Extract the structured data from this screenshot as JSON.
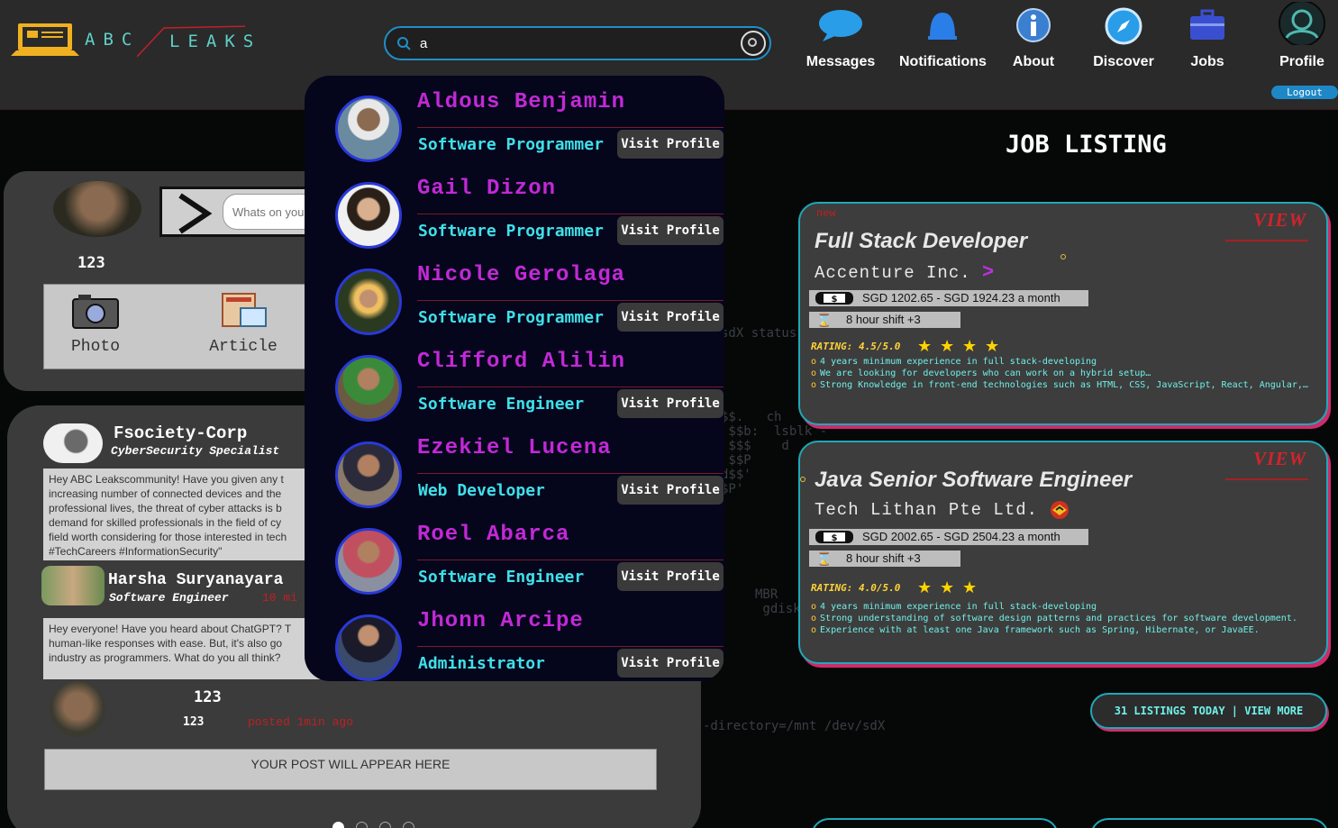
{
  "header": {
    "logo_left": "ABC",
    "logo_right": "LEAKS",
    "search_value": "a",
    "nav": [
      {
        "label": "Messages",
        "icon": "chat-bubble-icon"
      },
      {
        "label": "Notifications",
        "icon": "bell-icon"
      },
      {
        "label": "About",
        "icon": "info-icon"
      },
      {
        "label": "Discover",
        "icon": "compass-icon"
      },
      {
        "label": "Jobs",
        "icon": "briefcase-icon"
      },
      {
        "label": "Profile",
        "icon": "user-avatar-icon"
      }
    ],
    "logout": "Logout"
  },
  "composer": {
    "placeholder": "Whats on your mind?",
    "count": "123",
    "photo_label": "Photo",
    "article_label": "Article"
  },
  "feed": {
    "post1": {
      "author": "Fsociety-Corp",
      "role": "CyberSecurity Specialist",
      "body": "Hey ABC Leakscommunity! Have you given any t\nincreasing number of connected devices and the\nprofessional lives, the threat of cyber attacks is b\ndemand for skilled professionals in the field of cy\nfield worth considering for those interested in tech\n#TechCareers #InformationSecurity\""
    },
    "post2": {
      "author": "Harsha Suryanayara",
      "role": "Software Engineer",
      "time": "10 mi",
      "body": "Hey everyone! Have you heard about ChatGPT? T\nhuman-like responses with ease. But, it's also go\nindustry as programmers. What do you all think?"
    },
    "footer": {
      "count_a": "123",
      "count_b": "123",
      "posted": "posted 1min ago",
      "placeholder": "YOUR POST WILL APPEAR HERE"
    }
  },
  "search_results": [
    {
      "name": "Aldous Benjamin",
      "role": "Software Programmer",
      "button": "Visit Profile"
    },
    {
      "name": "Gail Dizon",
      "role": "Software Programmer",
      "button": "Visit Profile"
    },
    {
      "name": "Nicole Gerolaga",
      "role": "Software Programmer",
      "button": "Visit Profile"
    },
    {
      "name": "Clifford Alilin",
      "role": "Software Engineer",
      "button": "Visit Profile"
    },
    {
      "name": "Ezekiel Lucena",
      "role": "Web Developer",
      "button": "Visit Profile"
    },
    {
      "name": "Roel Abarca",
      "role": "Software Engineer",
      "button": "Visit Profile"
    },
    {
      "name": "Jhonn Arcipe",
      "role": "Administrator",
      "button": "Visit Profile"
    }
  ],
  "jobs": {
    "heading": "JOB LISTING",
    "listings": [
      {
        "badge": "new",
        "title": "Full Stack Developer",
        "company": "Accenture Inc.",
        "salary": "SGD 1202.65 - SGD 1924.23 a month",
        "shift": "8 hour shift +3",
        "rating": "RATING: 4.5/5.0",
        "stars": 4,
        "view": "VIEW",
        "bullets": [
          "4 years minimum experience in full stack-developing",
          "We are looking for developers who can work on a hybrid setup…",
          "Strong Knowledge in front-end technologies such as HTML, CSS, JavaScript, React, Angular,…"
        ]
      },
      {
        "badge": "",
        "title": "Java Senior Software Engineer",
        "company": "Tech Lithan Pte Ltd.",
        "salary": "SGD 2002.65 - SGD 2504.23 a month",
        "shift": "8 hour shift +3",
        "rating": "RATING: 4.0/5.0",
        "stars": 3,
        "view": "VIEW",
        "bullets": [
          "4 years minimum experience in full stack-developing",
          "Strong understanding of software design patterns and practices for software development.",
          "Experience with at least one Java framework such as Spring, Hibernate, or JavaEE."
        ]
      }
    ],
    "more": "31 LISTINGS TODAY | VIEW MORE"
  },
  "colors": {
    "accent_cyan": "#3fe0e8",
    "name_purple": "#c229d6",
    "view_red": "#d2232a",
    "border_blue": "#1f8fc8"
  }
}
